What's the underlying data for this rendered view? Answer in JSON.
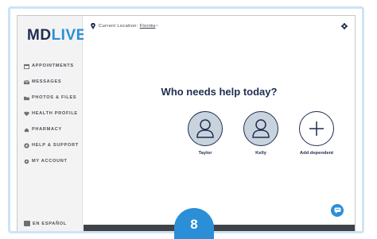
{
  "app": {
    "logo_text_main": "MD",
    "logo_text_accent": "LIVE"
  },
  "sidebar": {
    "items": [
      {
        "label": "APPOINTMENTS",
        "icon": "calendar-icon"
      },
      {
        "label": "MESSAGES",
        "icon": "envelope-icon"
      },
      {
        "label": "PHOTOS & FILES",
        "icon": "folder-icon"
      },
      {
        "label": "HEALTH PROFILE",
        "icon": "heart-icon"
      },
      {
        "label": "PHARMACY",
        "icon": "pharmacy-icon"
      },
      {
        "label": "HELP & SUPPORT",
        "icon": "help-icon"
      },
      {
        "label": "MY ACCOUNT",
        "icon": "gear-icon"
      }
    ],
    "language_label": "EN ESPAÑOL"
  },
  "header": {
    "location_prefix": "Current Location:",
    "location_value": "Florida",
    "location_suffix": "~"
  },
  "main": {
    "heading": "Who needs help today?",
    "people": [
      {
        "name": "Taylor",
        "icon": "user-icon"
      },
      {
        "name": "Kelly",
        "icon": "user-icon"
      },
      {
        "name": "Add dependent",
        "icon": "plus-icon"
      }
    ]
  },
  "step_badge": "8",
  "colors": {
    "brand_navy": "#1f2d4f",
    "brand_blue": "#2a8fd6",
    "avatar_fill": "#c8d3de"
  }
}
